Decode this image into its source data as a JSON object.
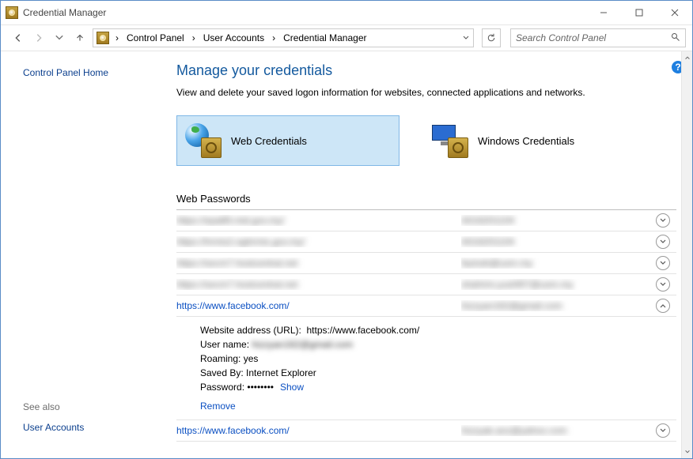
{
  "window": {
    "title": "Credential Manager"
  },
  "breadcrumb": {
    "items": [
      "Control Panel",
      "User Accounts",
      "Credential Manager"
    ]
  },
  "search": {
    "placeholder": "Search Control Panel"
  },
  "sidebar": {
    "home": "Control Panel Home",
    "see_also": "See also",
    "user_accounts": "User Accounts"
  },
  "main": {
    "heading": "Manage your credentials",
    "subheading": "View and delete your saved logon information for websites, connected applications and networks.",
    "tiles": {
      "web": "Web Credentials",
      "windows": "Windows Credentials"
    },
    "section": "Web Passwords",
    "rows": [
      {
        "url": "https://epa89.mid.gov.my/",
        "user": "A016201104",
        "expanded": false,
        "blur": true
      },
      {
        "url": "https://hrmis2.eghrmis.gov.my/",
        "user": "A016201104",
        "expanded": false,
        "blur": true
      },
      {
        "url": "https://secm7.hostcentral.net",
        "user": "fazirah@usm.my",
        "expanded": false,
        "blur": true
      },
      {
        "url": "https://secm7.hostcentral.net",
        "user": "shahrini.yushf07@usm.my",
        "expanded": false,
        "blur": true
      },
      {
        "url": "https://www.facebook.com/",
        "user": "hizzyan162@gmail.com",
        "expanded": true,
        "blur": false
      },
      {
        "url": "https://www.facebook.com/",
        "user": "hizzyak.anz@yahoo.com",
        "expanded": false,
        "blur": false
      }
    ],
    "detail": {
      "url_label": "Website address (URL):",
      "url_value": "https://www.facebook.com/",
      "user_label": "User name:",
      "user_value": "hizzyan162@gmail.com",
      "roaming_label": "Roaming:",
      "roaming_value": "yes",
      "saved_label": "Saved By:",
      "saved_value": "Internet Explorer",
      "password_label": "Password:",
      "password_value": "••••••••",
      "show": "Show",
      "remove": "Remove"
    }
  },
  "help": "?"
}
